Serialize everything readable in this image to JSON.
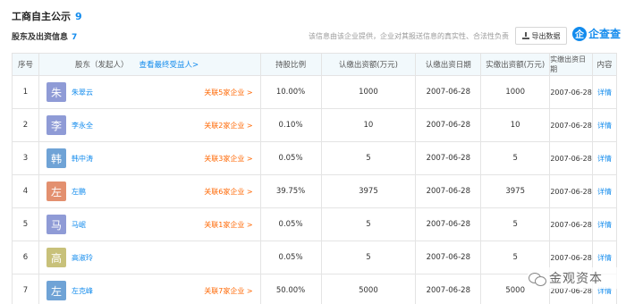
{
  "header": {
    "title": "工商自主公示",
    "title_count": "9",
    "subtitle": "股东及出资信息",
    "subtitle_count": "7",
    "notice": "该信息由该企业提供，企业对其报送信息的真实性、合法性负责",
    "export_label": "导出数据",
    "brand_logo_char": "企",
    "brand_text": "企查查"
  },
  "table": {
    "columns": {
      "no": "序号",
      "shareholder": "股东（发起人）",
      "beneficiary_link": "查看最终受益人>",
      "percent": "持股比例",
      "subscribed": "认缴出资额(万元)",
      "subscribed_date": "认缴出资日期",
      "paid": "实缴出资额(万元)",
      "paid_date": "实缴出资日期",
      "content": "内容"
    },
    "rows": [
      {
        "no": "1",
        "avatar_char": "朱",
        "avatar_color": "#8f9bd6",
        "name": "朱翠云",
        "related": "关联5家企业 >",
        "percent": "10.00%",
        "subscribed": "1000",
        "subscribed_date": "2007-06-28",
        "paid": "1000",
        "paid_date": "2007-06-28",
        "detail": "详情"
      },
      {
        "no": "2",
        "avatar_char": "李",
        "avatar_color": "#8f9bd6",
        "name": "李永全",
        "related": "关联2家企业 >",
        "percent": "0.10%",
        "subscribed": "10",
        "subscribed_date": "2007-06-28",
        "paid": "10",
        "paid_date": "2007-06-28",
        "detail": "详情"
      },
      {
        "no": "3",
        "avatar_char": "韩",
        "avatar_color": "#6fa3d6",
        "name": "韩中涛",
        "related": "关联3家企业 >",
        "percent": "0.05%",
        "subscribed": "5",
        "subscribed_date": "2007-06-28",
        "paid": "5",
        "paid_date": "2007-06-28",
        "detail": "详情"
      },
      {
        "no": "4",
        "avatar_char": "左",
        "avatar_color": "#e3906f",
        "name": "左鹏",
        "related": "关联6家企业 >",
        "percent": "39.75%",
        "subscribed": "3975",
        "subscribed_date": "2007-06-28",
        "paid": "3975",
        "paid_date": "2007-06-28",
        "detail": "详情"
      },
      {
        "no": "5",
        "avatar_char": "马",
        "avatar_color": "#8f9bd6",
        "name": "马岷",
        "related": "关联1家企业 >",
        "percent": "0.05%",
        "subscribed": "5",
        "subscribed_date": "2007-06-28",
        "paid": "5",
        "paid_date": "2007-06-28",
        "detail": "详情"
      },
      {
        "no": "6",
        "avatar_char": "高",
        "avatar_color": "#c8c17a",
        "name": "高淑玲",
        "related": "",
        "percent": "0.05%",
        "subscribed": "5",
        "subscribed_date": "2007-06-28",
        "paid": "5",
        "paid_date": "2007-06-28",
        "detail": "详情"
      },
      {
        "no": "7",
        "avatar_char": "左",
        "avatar_color": "#6fa3d6",
        "name": "左克峰",
        "related": "关联7家企业 >",
        "percent": "50.00%",
        "subscribed": "5000",
        "subscribed_date": "2007-06-28",
        "paid": "5000",
        "paid_date": "2007-06-28",
        "detail": "详情"
      }
    ]
  },
  "watermark": {
    "text": "金观资本",
    "icon": "wechat-icon"
  },
  "colors": {
    "link": "#128bed",
    "related": "#ff6600",
    "header_bg": "#f2f9fc"
  }
}
